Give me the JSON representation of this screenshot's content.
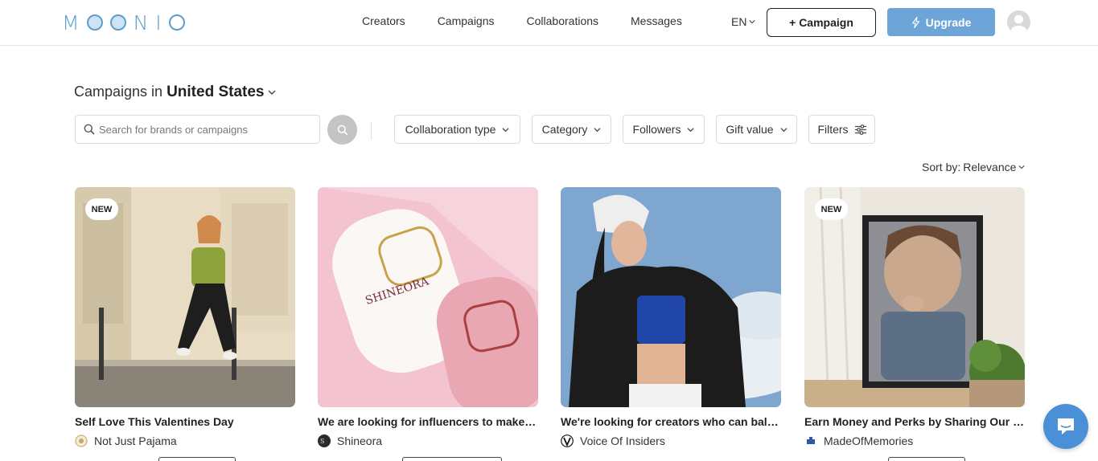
{
  "header": {
    "logo_text": "MOONIO",
    "nav": [
      "Creators",
      "Campaigns",
      "Collaborations",
      "Messages"
    ],
    "language": "EN",
    "campaign_button": "+ Campaign",
    "upgrade_button": "Upgrade"
  },
  "page": {
    "title_prefix": "Campaigns in",
    "country": "United States"
  },
  "search": {
    "placeholder": "Search for brands or campaigns",
    "value": ""
  },
  "filters": [
    "Collaboration type",
    "Category",
    "Followers",
    "Gift value",
    "Filters"
  ],
  "sort": {
    "label": "Sort by:",
    "value": "Relevance"
  },
  "cards": [
    {
      "badge": "NEW",
      "title": "Self Love This Valentines Day",
      "brand": "Not Just Pajama"
    },
    {
      "badge": "",
      "title": "We are looking for influencers to make o...",
      "brand": "Shineora"
    },
    {
      "badge": "",
      "title": "We're looking for creators who can balan...",
      "brand": "Voice Of Insiders"
    },
    {
      "badge": "NEW",
      "title": "Earn Money and Perks by Sharing Our Pr...",
      "brand": "MadeOfMemories"
    }
  ],
  "colors": {
    "brand_blue": "#5a9fd0",
    "upgrade_bg": "#6ea5d8",
    "chat_bg": "#4a90d9"
  },
  "icons": {
    "search": "search-icon",
    "chevron": "chevron-down-icon",
    "lightning": "lightning-icon",
    "sliders": "sliders-icon",
    "chat": "chat-icon",
    "avatar": "user-avatar-icon"
  }
}
